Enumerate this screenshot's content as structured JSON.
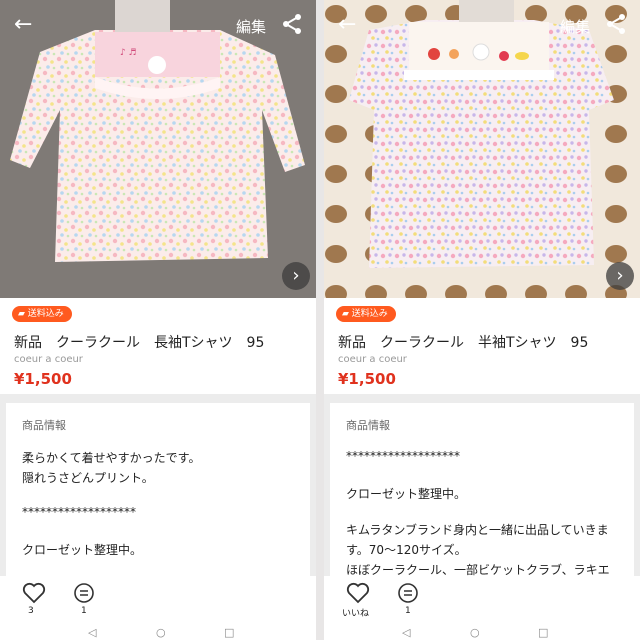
{
  "common": {
    "edit_label": "編集",
    "free_shipping": "送料込み",
    "brand": "coeur a coeur",
    "desc_label": "商品情報"
  },
  "left": {
    "title": "新品　クーラクール　長袖Tシャツ　95",
    "price": "¥1,500",
    "desc_lines": [
      "柔らかくて着せやすかったです。",
      "隠れうさどんプリント。",
      "*******************",
      "クローゼット整理中。"
    ],
    "like_count": "3",
    "comment_count": "1"
  },
  "right": {
    "title": "新品　クーラクール　半袖Tシャツ　95",
    "price": "¥1,500",
    "desc_lines": [
      "*******************",
      "クローゼット整理中。",
      "キムラタンブランド身内と一緒に出品していきま",
      "す。70〜120サイズ。",
      "ほぼクーラクール、一部ビケットクラブ、ラキエ"
    ],
    "like_label": "いいね",
    "comment_count": "1"
  },
  "icons": {
    "back": "back-arrow-icon",
    "share": "share-icon",
    "next": "chevron-right-icon",
    "like": "heart-icon",
    "comment": "comment-icon",
    "nav_back": "triangle-back-icon",
    "nav_home": "circle-home-icon",
    "nav_recent": "square-recent-icon"
  }
}
